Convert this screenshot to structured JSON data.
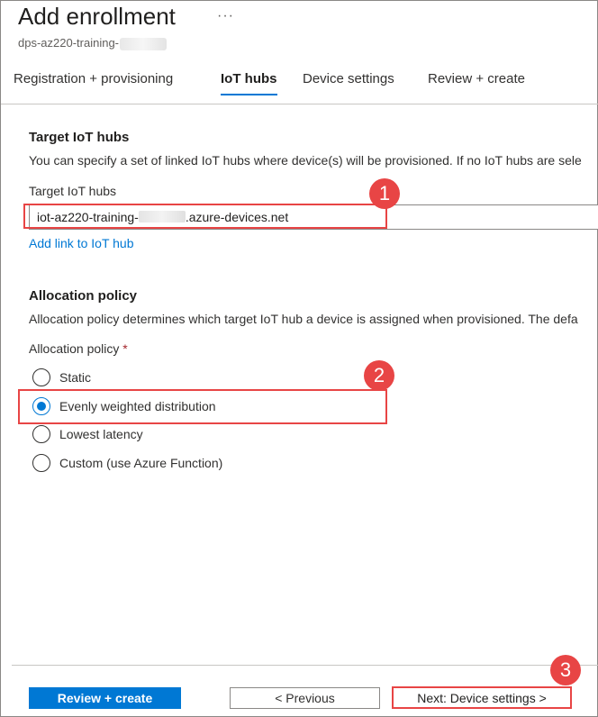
{
  "header": {
    "title": "Add enrollment",
    "more_icon": "ellipsis-icon",
    "subtitle": "dps-az220-training-"
  },
  "tabs": [
    {
      "label": "Registration + provisioning",
      "active": false
    },
    {
      "label": "IoT hubs",
      "active": true
    },
    {
      "label": "Device settings",
      "active": false
    },
    {
      "label": "Review + create",
      "active": false
    }
  ],
  "target_hubs": {
    "section_title": "Target IoT hubs",
    "description": "You can specify a set of linked IoT hubs where device(s) will be provisioned. If no IoT hubs are sele",
    "field_label": "Target IoT hubs",
    "value_prefix": "iot-az220-training-",
    "value_suffix": ".azure-devices.net",
    "add_link": "Add link to IoT hub"
  },
  "allocation": {
    "section_title": "Allocation policy",
    "description": "Allocation policy determines which target IoT hub a device is assigned when provisioned. The defa",
    "field_label": "Allocation policy",
    "required_mark": "*",
    "options": [
      {
        "label": "Static",
        "checked": false
      },
      {
        "label": "Evenly weighted distribution",
        "checked": true
      },
      {
        "label": "Lowest latency",
        "checked": false
      },
      {
        "label": "Custom (use Azure Function)",
        "checked": false
      }
    ]
  },
  "annotations": [
    "1",
    "2",
    "3"
  ],
  "footer": {
    "review_create": "Review + create",
    "previous": "< Previous",
    "next": "Next: Device settings >"
  },
  "colors": {
    "accent": "#0078d4",
    "annotation": "#e84545"
  }
}
